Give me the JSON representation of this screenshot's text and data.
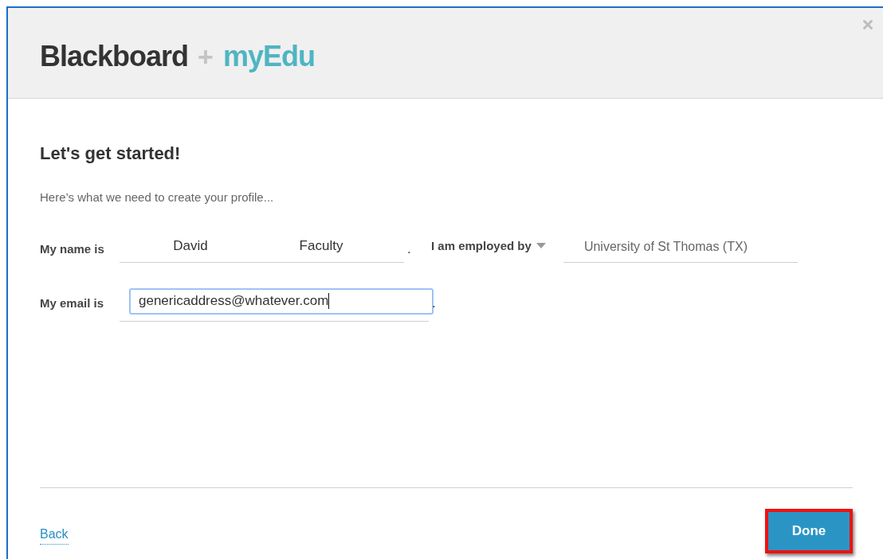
{
  "header": {
    "brand": "Blackboard",
    "plus": "+",
    "partner": "myEdu"
  },
  "heading": "Let's get started!",
  "intro": "Here’s what we need to create your profile...",
  "name_row": {
    "label": "My name is",
    "first_name": "David",
    "last_name": "Faculty",
    "period": ".",
    "employer_label": "I am employed by",
    "employer": "University of St Thomas (TX)"
  },
  "email_row": {
    "label": "My email is",
    "value": "genericaddress@whatever.com",
    "focused": true,
    "period": "."
  },
  "footer": {
    "back": "Back",
    "done": "Done",
    "done_highlighted": true
  }
}
